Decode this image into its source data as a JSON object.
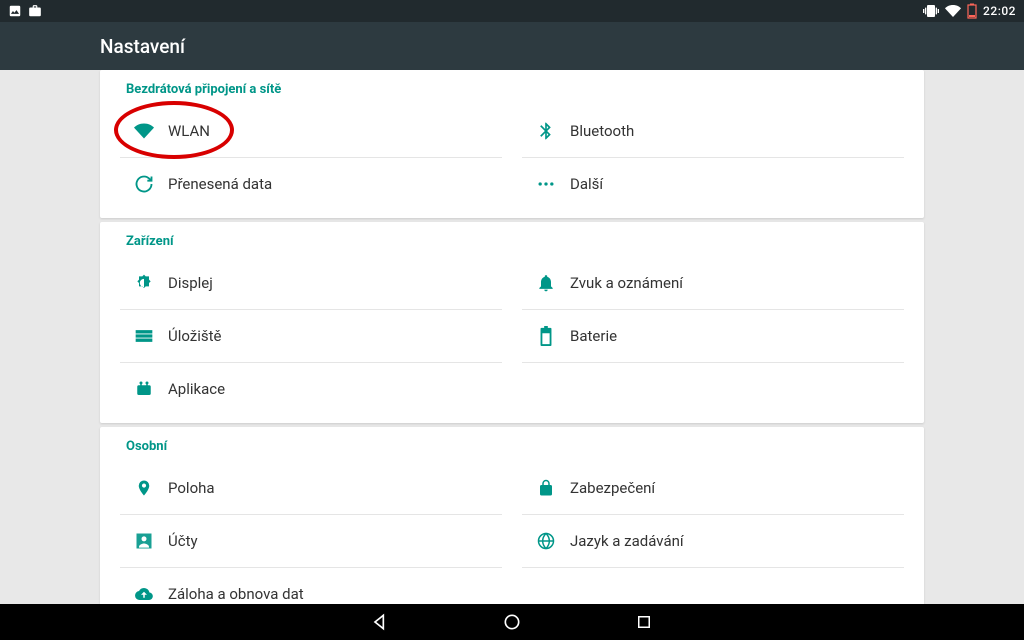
{
  "status": {
    "clock": "22:02"
  },
  "appbar": {
    "title": "Nastavení"
  },
  "sections": [
    {
      "header": "Bezdrátová připojení a sítě",
      "itemsLeft": [
        {
          "icon": "wifi",
          "label": "WLAN",
          "highlight": true
        },
        {
          "icon": "sync",
          "label": "Přenesená data"
        }
      ],
      "itemsRight": [
        {
          "icon": "bluetooth",
          "label": "Bluetooth"
        },
        {
          "icon": "more",
          "label": "Další"
        }
      ]
    },
    {
      "header": "Zařízení",
      "itemsLeft": [
        {
          "icon": "brightness",
          "label": "Displej"
        },
        {
          "icon": "storage",
          "label": "Úložiště"
        },
        {
          "icon": "apps",
          "label": "Aplikace"
        }
      ],
      "itemsRight": [
        {
          "icon": "bell",
          "label": "Zvuk a oznámení"
        },
        {
          "icon": "battery",
          "label": "Baterie"
        }
      ]
    },
    {
      "header": "Osobní",
      "itemsLeft": [
        {
          "icon": "location",
          "label": "Poloha"
        },
        {
          "icon": "account",
          "label": "Účty"
        },
        {
          "icon": "backup",
          "label": "Záloha a obnova dat"
        }
      ],
      "itemsRight": [
        {
          "icon": "lock",
          "label": "Zabezpečení"
        },
        {
          "icon": "globe",
          "label": "Jazyk a zadávání"
        }
      ]
    }
  ]
}
